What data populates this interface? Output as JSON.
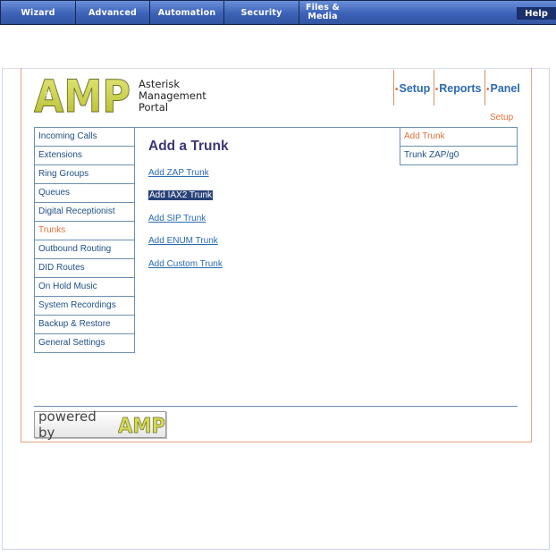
{
  "toolbar": {
    "tabs": [
      {
        "label": "Wizard"
      },
      {
        "label": "Advanced"
      },
      {
        "label": "Automation"
      },
      {
        "label": "Security"
      },
      {
        "label": "Files & Media"
      }
    ],
    "help_label": "Help"
  },
  "header": {
    "logo_text": "AMP",
    "portal_title_lines": [
      "Asterisk",
      "Management",
      "Portal"
    ],
    "nav": [
      {
        "label": "Setup"
      },
      {
        "label": "Reports"
      },
      {
        "label": "Panel"
      }
    ],
    "section_label": "Setup"
  },
  "sidebar": {
    "items": [
      {
        "label": "Incoming Calls",
        "active": false
      },
      {
        "label": "Extensions",
        "active": false
      },
      {
        "label": "Ring Groups",
        "active": false
      },
      {
        "label": "Queues",
        "active": false
      },
      {
        "label": "Digital Receptionist",
        "active": false
      },
      {
        "label": "Trunks",
        "active": true
      },
      {
        "label": "Outbound Routing",
        "active": false
      },
      {
        "label": "DID Routes",
        "active": false
      },
      {
        "label": "On Hold Music",
        "active": false
      },
      {
        "label": "System Recordings",
        "active": false
      },
      {
        "label": "Backup & Restore",
        "active": false
      },
      {
        "label": "General Settings",
        "active": false
      }
    ]
  },
  "main": {
    "title": "Add a Trunk",
    "links": [
      {
        "label": "Add ZAP Trunk",
        "selected": false
      },
      {
        "label": "Add IAX2 Trunk",
        "selected": true
      },
      {
        "label": "Add SIP Trunk",
        "selected": false
      },
      {
        "label": "Add ENUM Trunk",
        "selected": false
      },
      {
        "label": "Add Custom Trunk",
        "selected": false
      }
    ]
  },
  "right_panel": {
    "items": [
      {
        "label": "Add Trunk",
        "active": true
      },
      {
        "label": "Trunk ZAP/g0",
        "active": false
      }
    ]
  },
  "footer": {
    "powered_text": "powered by",
    "powered_logo": "AMP"
  },
  "colors": {
    "toolbar": "#3c62b8",
    "link": "#2a6bb0",
    "active": "#e3703b",
    "title": "#3b3776",
    "logo_fill": "#c9cf45",
    "logo_outline": "#6d6e2a"
  }
}
